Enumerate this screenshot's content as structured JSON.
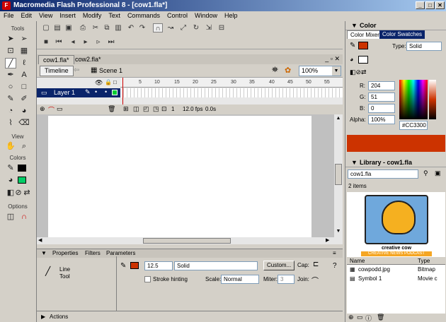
{
  "window": {
    "title": "Macromedia Flash Professional 8 - [cow1.fla*]",
    "app_icon": "F",
    "controls": [
      "_",
      "□",
      "✕"
    ]
  },
  "menu": [
    "File",
    "Edit",
    "View",
    "Insert",
    "Modify",
    "Text",
    "Commands",
    "Control",
    "Window",
    "Help"
  ],
  "tools": {
    "section_tools": "Tools",
    "section_view": "View",
    "section_colors": "Colors",
    "section_options": "Options",
    "stroke_color": "#000000",
    "fill_color": "#CC3300"
  },
  "documents": {
    "tabs": [
      {
        "label": "cow1.fla*",
        "active": true
      },
      {
        "label": "cow2.fla*",
        "active": false
      }
    ]
  },
  "scene": {
    "timeline_button": "Timeline",
    "scene_label": "Scene 1",
    "zoom": "100%"
  },
  "timeline": {
    "frame_numbers": [
      "5",
      "10",
      "15",
      "20",
      "25",
      "30",
      "35",
      "40",
      "45",
      "50",
      "55"
    ],
    "layer_name": "Layer 1",
    "current_frame": "1",
    "fps": "12.0 fps",
    "time": "0.0s"
  },
  "properties": {
    "tabs": [
      "Properties",
      "Filters",
      "Parameters"
    ],
    "tool_name_line1": "Line",
    "tool_name_line2": "Tool",
    "stroke_width": "12.5",
    "stroke_style": "Solid",
    "custom_button": "Custom...",
    "cap_label": "Cap:",
    "stroke_hinting": "Stroke hinting",
    "scale_label": "Scale:",
    "scale_value": "Normal",
    "miter_label": "Miter:",
    "miter_value": "3",
    "join_label": "Join:"
  },
  "actions": {
    "label": "Actions"
  },
  "color_panel": {
    "title": "Color",
    "tab_mixer": "Color Mixer",
    "tab_swatches": "Color Swatches",
    "type_label": "Type:",
    "type_value": "Solid",
    "r_label": "R:",
    "r_value": "204",
    "g_label": "G:",
    "g_value": "51",
    "b_label": "B:",
    "b_value": "0",
    "alpha_label": "Alpha:",
    "alpha_value": "100%",
    "hex_value": "#CC3300"
  },
  "library_panel": {
    "title": "Library - cow1.fla",
    "file": "cow1.fla",
    "item_count": "2 items",
    "preview_text": "creative cow",
    "preview_subtext": "CREATIVE NEWS PODCAST",
    "col_name": "Name",
    "col_type": "Type",
    "items": [
      {
        "name": "cowpodd.jpg",
        "type": "Bitmap"
      },
      {
        "name": "Symbol 1",
        "type": "Movie c"
      }
    ]
  }
}
